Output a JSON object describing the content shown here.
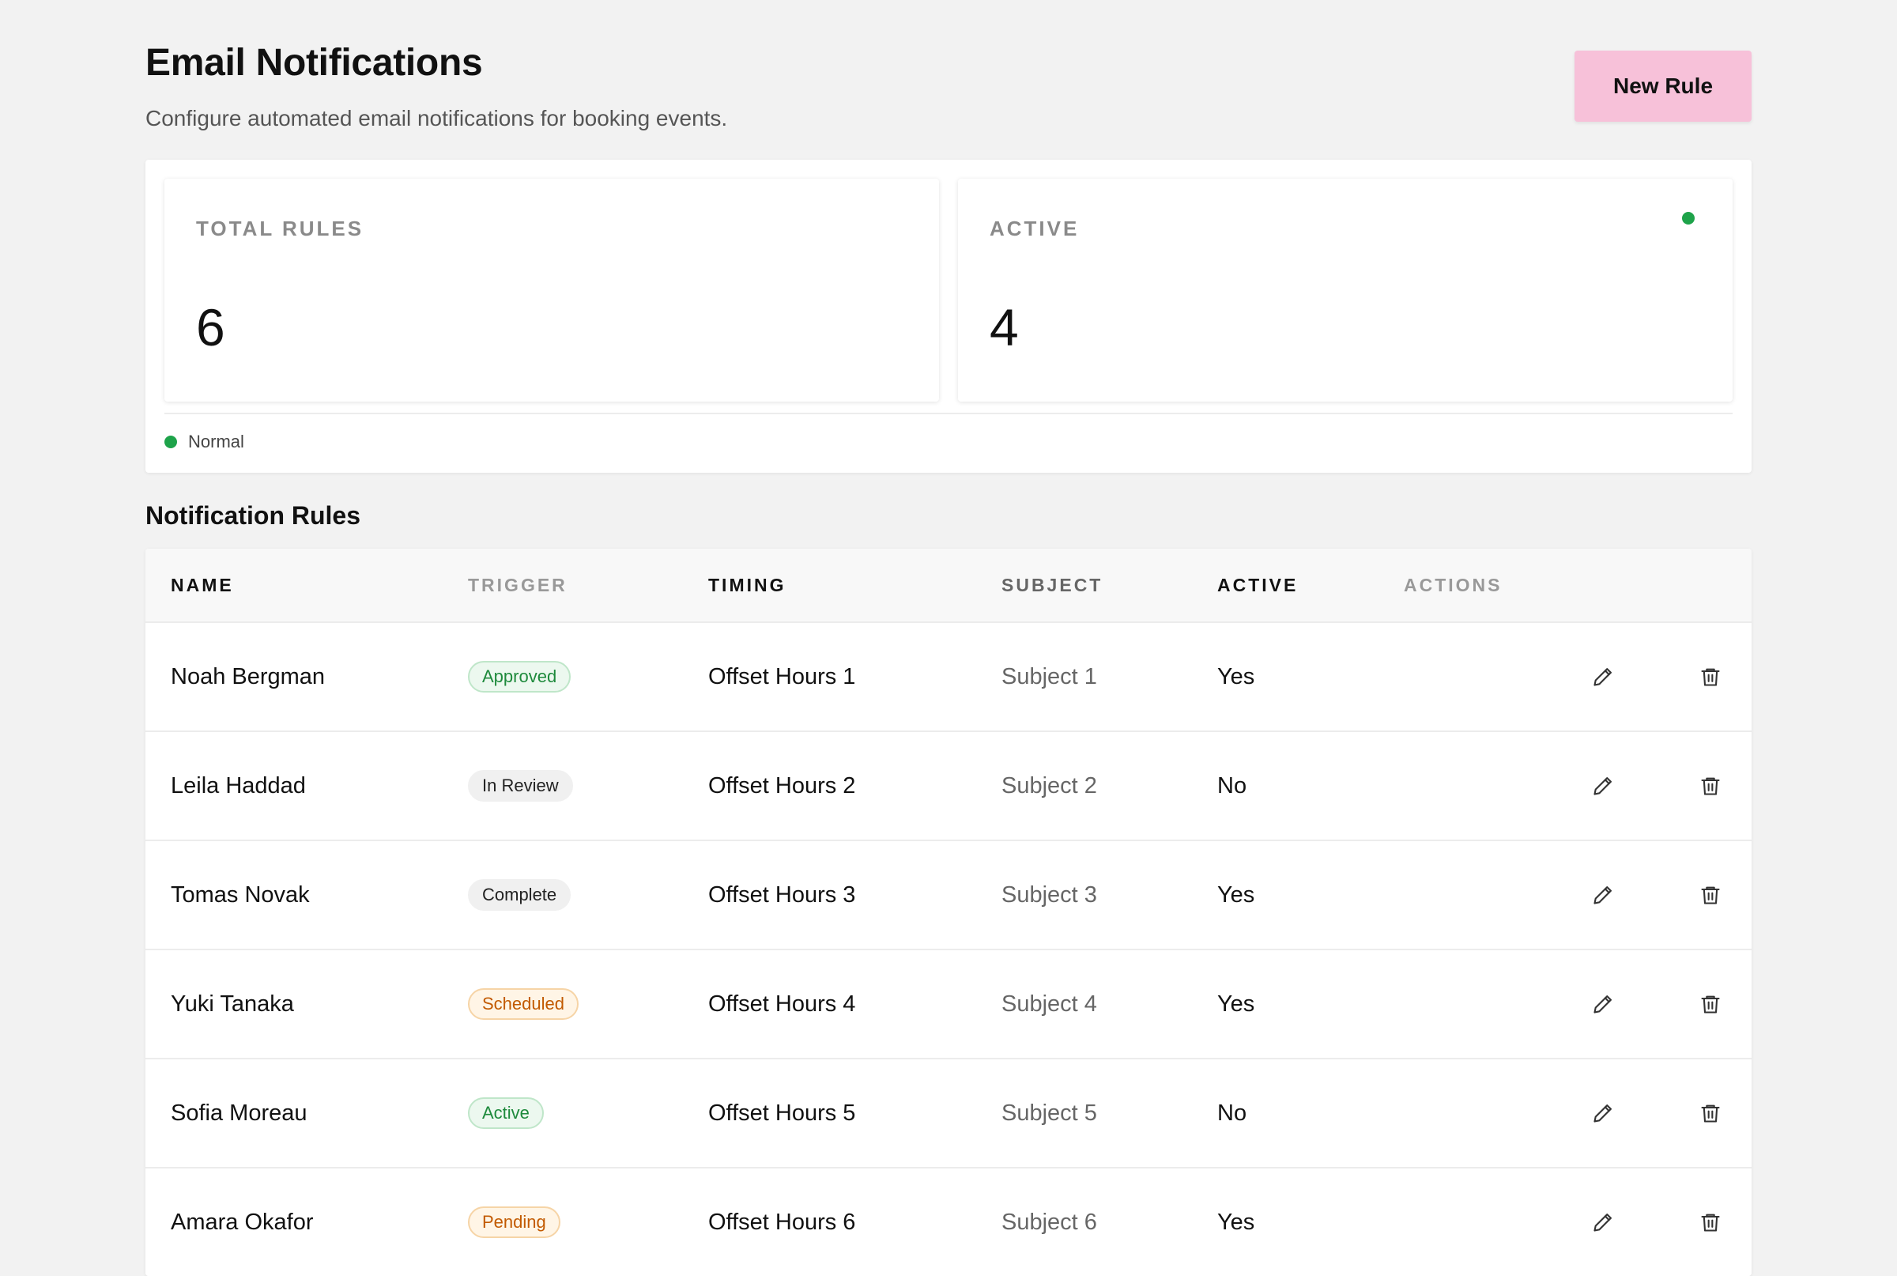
{
  "header": {
    "title": "Email Notifications",
    "subtitle": "Configure automated email notifications for booking events.",
    "new_rule_label": "New Rule"
  },
  "stats": {
    "total": {
      "label": "TOTAL RULES",
      "value": "6"
    },
    "active": {
      "label": "ACTIVE",
      "value": "4",
      "indicator_color": "#1ea34a"
    },
    "legend": {
      "label": "Normal",
      "color": "#1ea34a"
    }
  },
  "rules": {
    "section_title": "Notification Rules",
    "columns": {
      "name": "NAME",
      "trigger": "TRIGGER",
      "timing": "TIMING",
      "subject": "SUBJECT",
      "active": "ACTIVE",
      "actions": "ACTIONS"
    },
    "rows": [
      {
        "name": "Noah Bergman",
        "trigger": "Approved",
        "trigger_style": "green",
        "timing": "Offset Hours 1",
        "subject": "Subject 1",
        "active": "Yes"
      },
      {
        "name": "Leila Haddad",
        "trigger": "In Review",
        "trigger_style": "gray",
        "timing": "Offset Hours 2",
        "subject": "Subject 2",
        "active": "No"
      },
      {
        "name": "Tomas Novak",
        "trigger": "Complete",
        "trigger_style": "gray",
        "timing": "Offset Hours 3",
        "subject": "Subject 3",
        "active": "Yes"
      },
      {
        "name": "Yuki Tanaka",
        "trigger": "Scheduled",
        "trigger_style": "orange",
        "timing": "Offset Hours 4",
        "subject": "Subject 4",
        "active": "Yes"
      },
      {
        "name": "Sofia Moreau",
        "trigger": "Active",
        "trigger_style": "green",
        "timing": "Offset Hours 5",
        "subject": "Subject 5",
        "active": "No"
      },
      {
        "name": "Amara Okafor",
        "trigger": "Pending",
        "trigger_style": "orange",
        "timing": "Offset Hours 6",
        "subject": "Subject 6",
        "active": "Yes"
      }
    ]
  },
  "icons": {
    "edit": "pencil-icon",
    "delete": "trash-icon"
  },
  "colors": {
    "background": "#f2f2f2",
    "primary_button": "#f7c1d9",
    "status_green": "#1ea34a"
  }
}
